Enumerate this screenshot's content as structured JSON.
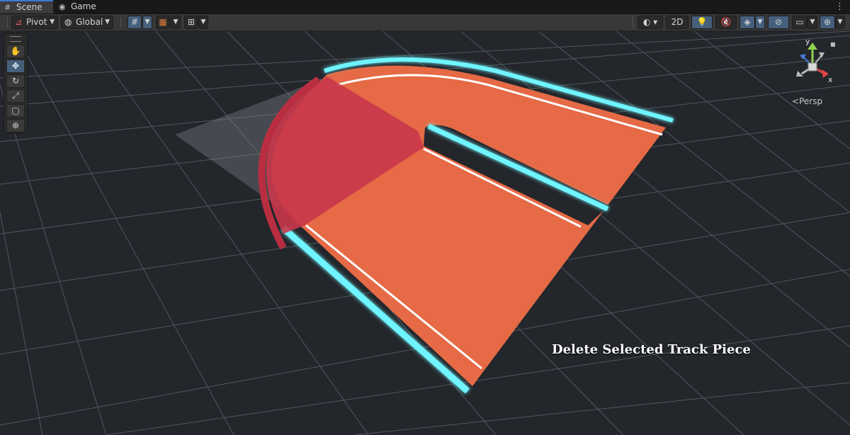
{
  "tabs": [
    {
      "label": "Scene",
      "icon": "hash-icon"
    },
    {
      "label": "Game",
      "icon": "gamepad-icon"
    }
  ],
  "toolbar": {
    "pivot_label": "Pivot",
    "global_label": "Global",
    "mode_2d_label": "2D"
  },
  "gizmo": {
    "y_label": "y",
    "x_label": "x",
    "projection_label": "Persp"
  },
  "tools": [
    "hand-tool",
    "move-tool",
    "rotate-tool",
    "scale-tool",
    "rect-tool",
    "transform-tool"
  ],
  "caption": "Delete Selected Track Piece",
  "colors": {
    "track": "#e56a45",
    "selected_overlay": "#c9364a",
    "edge_glow": "#6ff4ff",
    "grid": "#5a6068",
    "accent": "#46607c"
  }
}
